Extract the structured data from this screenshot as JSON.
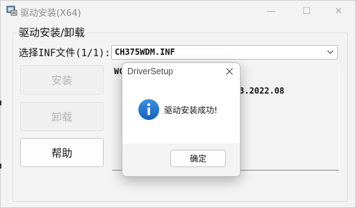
{
  "window": {
    "title": "驱动安装(X64)",
    "minimize_glyph": "—",
    "maximize_glyph": "☐",
    "close_glyph": "✕"
  },
  "group": {
    "title": "驱动安装/卸载"
  },
  "inf": {
    "label": "选择INF文件(1/1):",
    "selected": "CH375WDM.INF"
  },
  "buttons": {
    "install": "安装",
    "uninstall": "卸载",
    "help": "帮助"
  },
  "info_panel": {
    "line1": "WC",
    "line2": "3.2022.08"
  },
  "dialog": {
    "title": "DriverSetup",
    "message": "驱动安装成功!",
    "ok_label": "确定"
  },
  "icons": {
    "app": "app-icon",
    "dropdown": "chevron-down-icon",
    "dialog_close": "close-icon",
    "info": "info-icon"
  },
  "colors": {
    "accent": "#1a6fc7",
    "window_bg": "#f3f3f3",
    "disabled_text": "#b4b4b4"
  }
}
